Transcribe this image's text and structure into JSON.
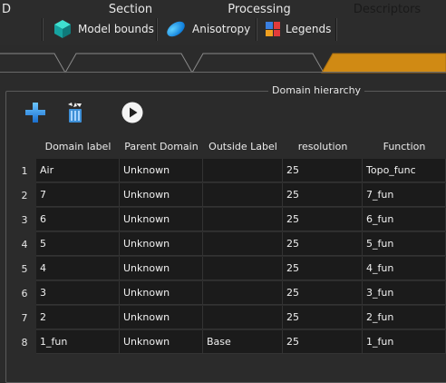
{
  "toolbar": {
    "buttons": [
      {
        "label": "Model bounds",
        "icon": "cube-icon"
      },
      {
        "label": "Anisotropy",
        "icon": "ellipsoid-icon"
      },
      {
        "label": "Legends",
        "icon": "legend-grid-icon"
      }
    ]
  },
  "tabs": [
    {
      "label": "D",
      "active": false
    },
    {
      "label": "Section",
      "active": false
    },
    {
      "label": "Processing",
      "active": false
    },
    {
      "label": "Descriptors",
      "active": true
    }
  ],
  "group": {
    "title": "Domain hierarchy"
  },
  "actions": [
    {
      "name": "add-icon"
    },
    {
      "name": "delete-icon"
    },
    {
      "name": "play-icon"
    }
  ],
  "table": {
    "columns": [
      "Domain label",
      "Parent Domain",
      "Outside Label",
      "resolution",
      "Function"
    ],
    "rows": [
      {
        "num": "1",
        "cells": [
          "Air",
          "Unknown",
          "",
          "25",
          "Topo_func"
        ]
      },
      {
        "num": "2",
        "cells": [
          "7",
          "Unknown",
          "",
          "25",
          "7_fun"
        ]
      },
      {
        "num": "3",
        "cells": [
          "6",
          "Unknown",
          "",
          "25",
          "6_fun"
        ]
      },
      {
        "num": "4",
        "cells": [
          "5",
          "Unknown",
          "",
          "25",
          "5_fun"
        ]
      },
      {
        "num": "5",
        "cells": [
          "4",
          "Unknown",
          "",
          "25",
          "4_fun"
        ]
      },
      {
        "num": "6",
        "cells": [
          "3",
          "Unknown",
          "",
          "25",
          "3_fun"
        ]
      },
      {
        "num": "7",
        "cells": [
          "2",
          "Unknown",
          "",
          "25",
          "2_fun"
        ]
      },
      {
        "num": "8",
        "cells": [
          "1_fun",
          "Unknown",
          "Base",
          "25",
          "1_fun"
        ]
      }
    ]
  },
  "colors": {
    "active_tab": "#d08a14",
    "background": "#2b2b2b",
    "cell": "#1b1b1b"
  }
}
